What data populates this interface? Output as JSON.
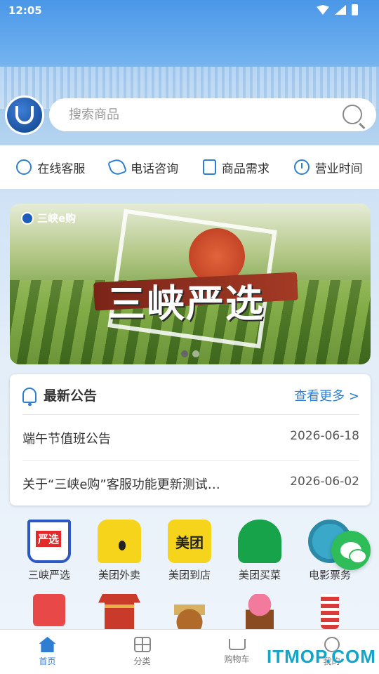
{
  "status_bar": {
    "time": "12:05"
  },
  "search": {
    "placeholder": "搜索商品"
  },
  "services": [
    {
      "label": "在线客服",
      "icon": "chat-bubble-icon"
    },
    {
      "label": "电话咨询",
      "icon": "phone-icon"
    },
    {
      "label": "商品需求",
      "icon": "document-icon"
    },
    {
      "label": "营业时间",
      "icon": "clock-icon"
    }
  ],
  "banner": {
    "brand": "三峡e购",
    "title": "三峡严选",
    "slide_count": 2,
    "active_slide": 1
  },
  "notice": {
    "title": "最新公告",
    "more": "查看更多 >",
    "items": [
      {
        "title": "端午节值班公告",
        "date": "2026-06-18"
      },
      {
        "title": "关于“三峡e购”客服功能更新测试…",
        "date": "2026-06-02"
      }
    ]
  },
  "grid": [
    {
      "label": "三峡严选",
      "icon": "yanxuan-cart-icon"
    },
    {
      "label": "美团外卖",
      "icon": "meituan-waimai-icon"
    },
    {
      "label": "美团到店",
      "icon": "meituan-icon",
      "icon_text": "美团"
    },
    {
      "label": "美团买菜",
      "icon": "elephant-icon"
    },
    {
      "label": "电影票务",
      "icon": "film-reel-icon"
    }
  ],
  "grid_row2_icons": [
    "red-box-icon",
    "gate-icon",
    "rice-icon",
    "cupcake-icon",
    "drink-cup-icon"
  ],
  "tabbar": [
    {
      "label": "首页",
      "icon": "home-icon",
      "active": true
    },
    {
      "label": "分类",
      "icon": "category-icon",
      "active": false
    },
    {
      "label": "购物车",
      "icon": "cart-icon",
      "active": false
    },
    {
      "label": "我的",
      "icon": "user-icon",
      "active": false
    }
  ],
  "watermark": "ITMOP.COM",
  "colors": {
    "accent": "#2e7fd3",
    "wechat": "#2fbd59"
  }
}
